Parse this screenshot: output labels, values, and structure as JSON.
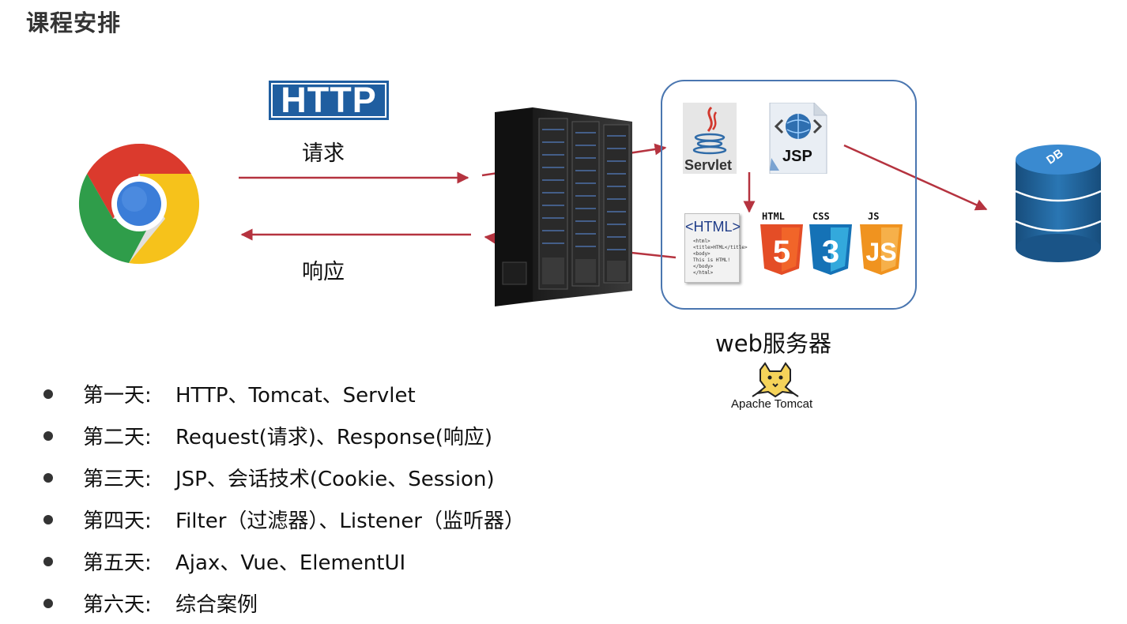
{
  "title": "课程安排",
  "http_logo": "HTTP",
  "request_label": "请求",
  "response_label": "响应",
  "servlet_label": "Servlet",
  "jsp_label": "JSP",
  "html_doc": {
    "heading": "<HTML>",
    "lines": [
      "<html>",
      "<title>HTML</title>",
      "<body>",
      "This is HTML!",
      "</body>",
      "</html>"
    ]
  },
  "tech_icons": [
    "HTML",
    "CSS",
    "JS"
  ],
  "db_label": "DB",
  "web_server_label": "web服务器",
  "tomcat_label": "Apache Tomcat",
  "schedule": [
    {
      "day": "第一天:",
      "content": "HTTP、Tomcat、Servlet"
    },
    {
      "day": "第二天:",
      "content": "Request(请求)、Response(响应)"
    },
    {
      "day": "第三天:",
      "content": "JSP、会话技术(Cookie、Session)"
    },
    {
      "day": "第四天:",
      "content": "Filter（过滤器）、Listener（监听器）"
    },
    {
      "day": "第五天:",
      "content": "Ajax、Vue、ElementUI"
    },
    {
      "day": "第六天:",
      "content": "综合案例"
    }
  ],
  "colors": {
    "arrow": "#b5333f",
    "server_border": "#4a76b0",
    "http_blue": "#1f5ea0",
    "db_blue": "#1e5f94",
    "html5_orange": "#e44d26",
    "css3_blue": "#1572b6",
    "js_orange": "#f0931f"
  }
}
